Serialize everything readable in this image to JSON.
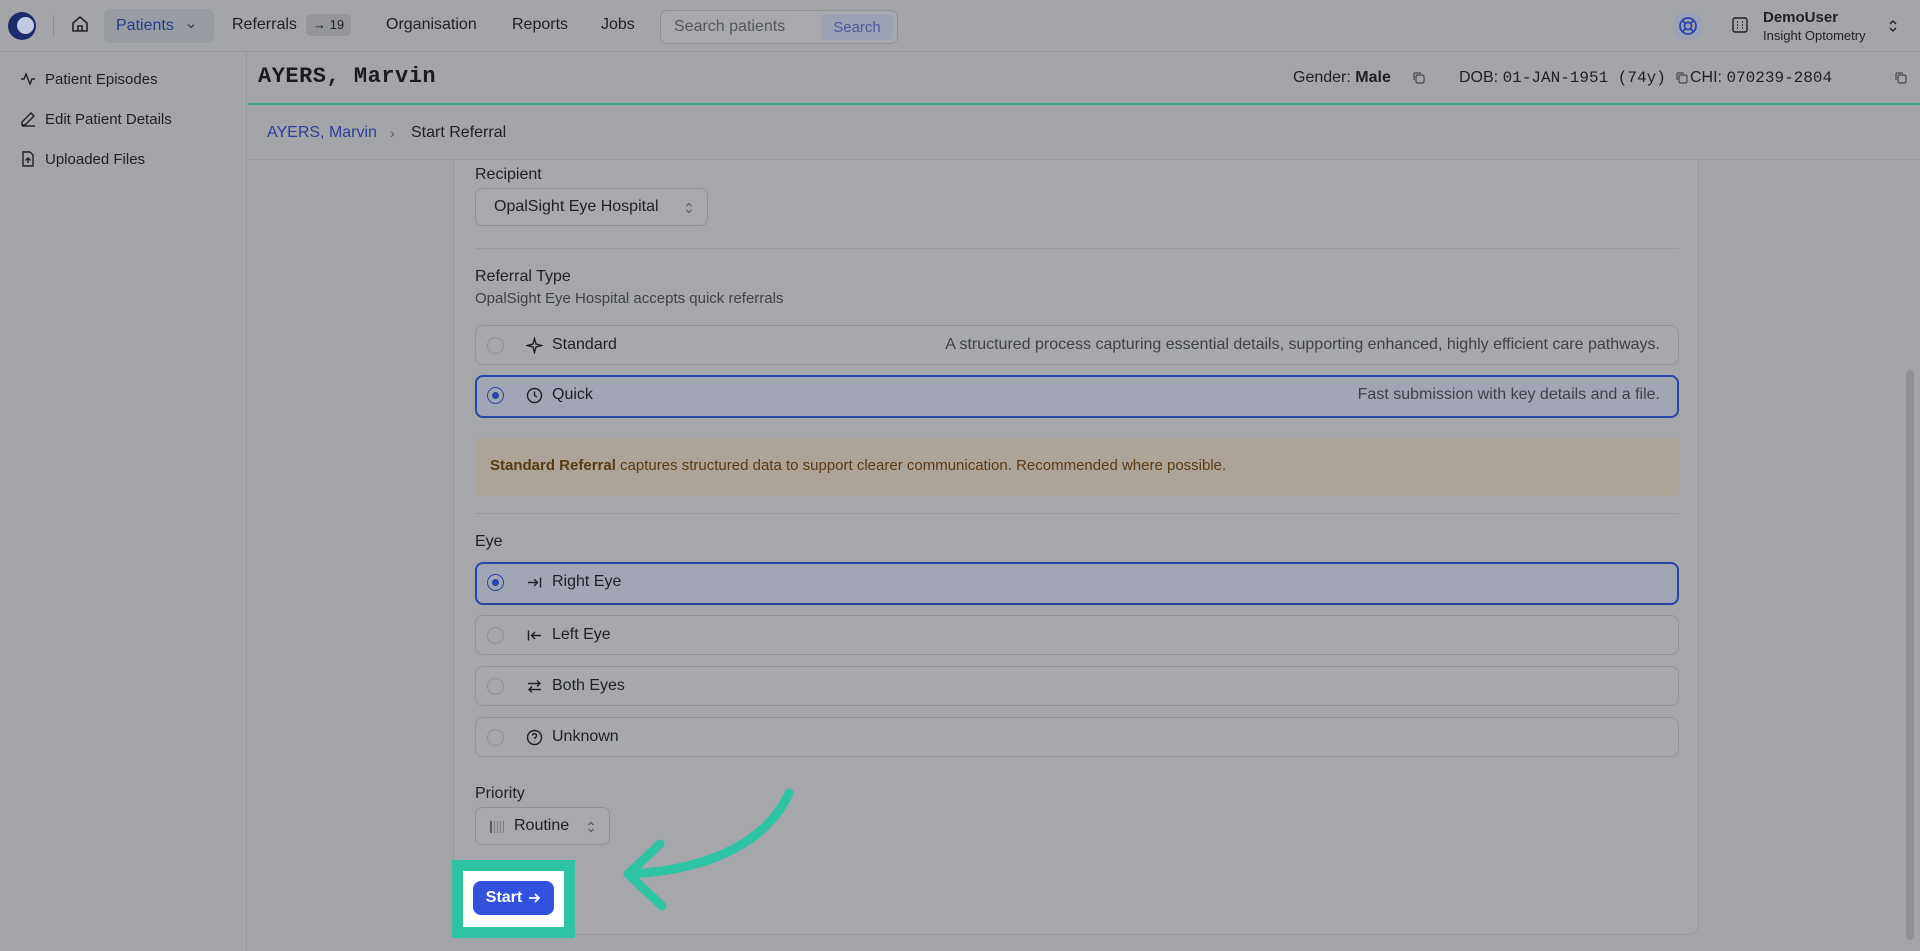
{
  "nav": {
    "patients": "Patients",
    "referrals": "Referrals",
    "referrals_badge": "→ 19",
    "organisation": "Organisation",
    "reports": "Reports",
    "jobs": "Jobs",
    "search_placeholder": "Search patients",
    "search_button": "Search"
  },
  "user": {
    "name": "DemoUser",
    "org": "Insight Optometry"
  },
  "sidebar": {
    "items": [
      {
        "label": "Patient Episodes",
        "icon": "activity-icon"
      },
      {
        "label": "Edit Patient Details",
        "icon": "pencil-icon"
      },
      {
        "label": "Uploaded Files",
        "icon": "file-icon"
      }
    ]
  },
  "patient": {
    "name": "AYERS, Marvin",
    "gender_label": "Gender:",
    "gender": "Male",
    "dob_label": "DOB:",
    "dob": "01-JAN-1951 (74y)",
    "chi_label": "CHI:",
    "chi": "070239-2804"
  },
  "breadcrumb": {
    "patient": "AYERS, Marvin",
    "separator": "›",
    "current": "Start Referral"
  },
  "form": {
    "recipient_label": "Recipient",
    "recipient_value": "OpalSight Eye Hospital",
    "referral_type_label": "Referral Type",
    "referral_type_hint": "OpalSight Eye Hospital accepts quick referrals",
    "referral_types": [
      {
        "label": "Standard",
        "description": "A structured process capturing essential details, supporting enhanced, highly efficient care pathways.",
        "selected": false
      },
      {
        "label": "Quick",
        "description": "Fast submission with key details and a file.",
        "selected": true
      }
    ],
    "notice_bold": "Standard Referral",
    "notice_text": " captures structured data to support clearer communication. Recommended where possible.",
    "eye_label": "Eye",
    "eyes": [
      {
        "label": "Right Eye",
        "selected": true
      },
      {
        "label": "Left Eye",
        "selected": false
      },
      {
        "label": "Both Eyes",
        "selected": false
      },
      {
        "label": "Unknown",
        "selected": false
      }
    ],
    "priority_label": "Priority",
    "priority_value": "Routine",
    "start_label": "Start"
  },
  "colors": {
    "accent": "#3450df",
    "highlight": "#2ec3a3",
    "header_underline": "#3ea58b"
  }
}
